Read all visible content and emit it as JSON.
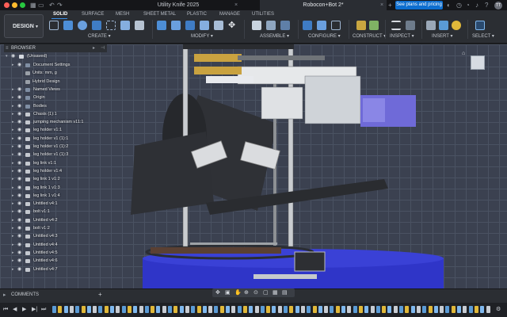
{
  "titlebar": {
    "tabs": [
      {
        "label": "Utility Knife 2025",
        "active": false
      },
      {
        "label": "Robocon+Bot 2*",
        "active": true
      }
    ],
    "plans_button": "See plans and pricing",
    "user_initials": "TT"
  },
  "toolbar": {
    "workspace": "DESIGN",
    "tabs": [
      "SOLID",
      "SURFACE",
      "MESH",
      "SHEET METAL",
      "PLASTIC",
      "MANAGE",
      "UTILITIES"
    ],
    "active_tab": "SOLID",
    "groups": [
      "CREATE",
      "MODIFY",
      "ASSEMBLE",
      "CONFIGURE",
      "CONSTRUCT",
      "INSPECT",
      "INSERT",
      "SELECT"
    ]
  },
  "browser": {
    "title": "BROWSER",
    "root": "(Unsaved)",
    "items": [
      {
        "label": "Document Settings",
        "indent": 1
      },
      {
        "label": "Units: mm, g",
        "indent": 2
      },
      {
        "label": "Hybrid Design",
        "indent": 2
      },
      {
        "label": "Named Views",
        "indent": 1
      },
      {
        "label": "Origin",
        "indent": 1
      },
      {
        "label": "Bodies",
        "indent": 1
      },
      {
        "label": "Chasis (1):1",
        "indent": 1
      },
      {
        "label": "jumping mechanism v11:1",
        "indent": 1
      },
      {
        "label": "leg holder v1:1",
        "indent": 1
      },
      {
        "label": "leg holder v1 (1):1",
        "indent": 1
      },
      {
        "label": "leg holder v1 (1):2",
        "indent": 1
      },
      {
        "label": "leg holder v1 (1):3",
        "indent": 1
      },
      {
        "label": "leg link v1:1",
        "indent": 1
      },
      {
        "label": "leg holder v1:4",
        "indent": 1
      },
      {
        "label": "leg link 1 v1:2",
        "indent": 1
      },
      {
        "label": "leg link 1 v1:3",
        "indent": 1
      },
      {
        "label": "leg link 1 v1:4",
        "indent": 1
      },
      {
        "label": "Untitled v4:1",
        "indent": 1
      },
      {
        "label": "bolt v1:1",
        "indent": 1
      },
      {
        "label": "Untitled v4:2",
        "indent": 1
      },
      {
        "label": "bolt v1:2",
        "indent": 1
      },
      {
        "label": "Untitled v4:3",
        "indent": 1
      },
      {
        "label": "Untitled v4:4",
        "indent": 1
      },
      {
        "label": "Untitled v4:5",
        "indent": 1
      },
      {
        "label": "Untitled v4:6",
        "indent": 1
      },
      {
        "label": "Untitled v4:7",
        "indent": 1
      }
    ]
  },
  "comments": {
    "label": "COMMENTS"
  },
  "colors": {
    "accent": "#0d6ecf",
    "viewport_bg": "#3b4150",
    "grid": "#4a5262",
    "base_blue": "#2e33c9"
  }
}
